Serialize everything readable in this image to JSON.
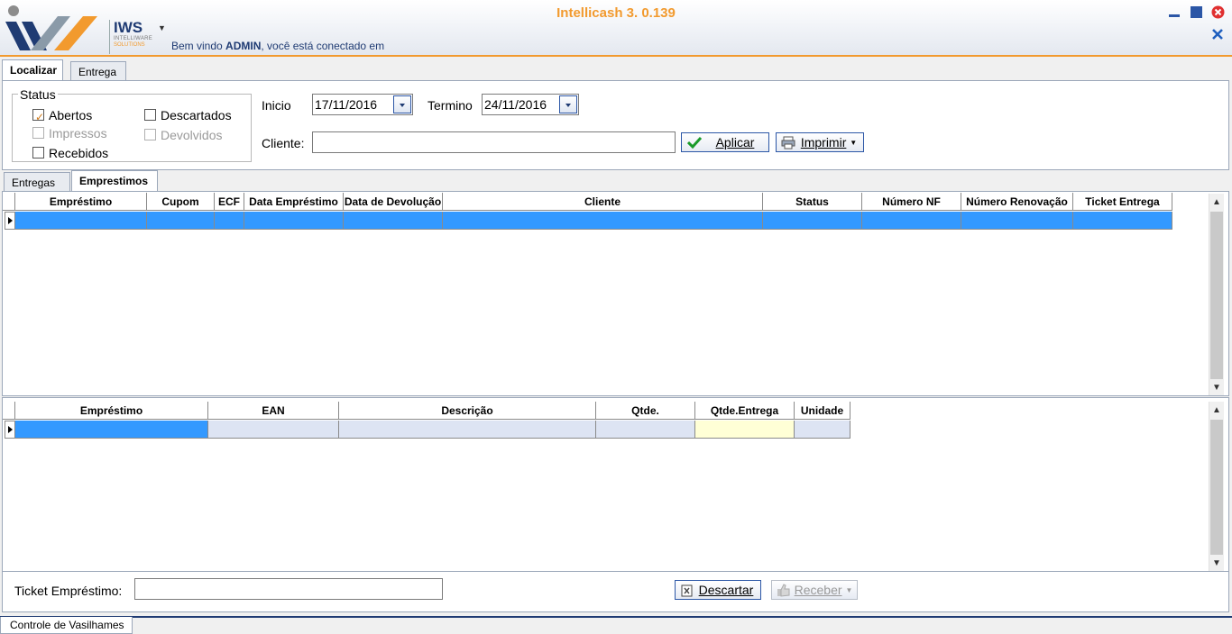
{
  "app": {
    "title": "Intellicash 3. 0.139",
    "brand": "IWS",
    "brand_sub1": "INTELLIWARE",
    "brand_sub2": "SOLUTIONS",
    "welcome_prefix": "Bem vindo ",
    "welcome_user": "ADMIN",
    "welcome_suffix": ", você está conectado em",
    "accent_color": "#f29a2e",
    "brand_color": "#1f3b73"
  },
  "top_tabs": [
    {
      "label": "Localizar",
      "active": true
    },
    {
      "label": "Entrega",
      "active": false
    }
  ],
  "filters": {
    "status_label": "Status",
    "checkboxes": [
      {
        "label": "Abertos",
        "checked": true,
        "enabled": true
      },
      {
        "label": "Descartados",
        "checked": false,
        "enabled": true
      },
      {
        "label": "Impressos",
        "checked": false,
        "enabled": false
      },
      {
        "label": "Devolvidos",
        "checked": false,
        "enabled": false
      },
      {
        "label": "Recebidos",
        "checked": false,
        "enabled": true
      }
    ],
    "inicio_label": "Inicio",
    "inicio_value": "17/11/2016",
    "termino_label": "Termino",
    "termino_value": "24/11/2016",
    "cliente_label": "Cliente:",
    "cliente_value": "",
    "aplicar_label": "Aplicar",
    "imprimir_label": "Imprimir"
  },
  "inner_tabs": [
    {
      "label": "Entregas",
      "active": false
    },
    {
      "label": "Emprestimos",
      "active": true
    }
  ],
  "grid_top": {
    "columns": [
      "Empréstimo",
      "Cupom",
      "ECF",
      "Data Empréstimo",
      "Data de Devolução",
      "Cliente",
      "Status",
      "Número NF",
      "Número Renovação",
      "Ticket Entrega"
    ],
    "selected_row_color": "#3399ff"
  },
  "grid_bottom": {
    "columns": [
      "Empréstimo",
      "EAN",
      "Descrição",
      "Qtde.",
      "Qtde.Entrega",
      "Unidade"
    ]
  },
  "footer": {
    "ticket_label": "Ticket Empréstimo:",
    "ticket_value": "",
    "descartar_label": "Descartar",
    "receber_label": "Receber",
    "bottom_tab": "Controle de Vasilhames"
  }
}
